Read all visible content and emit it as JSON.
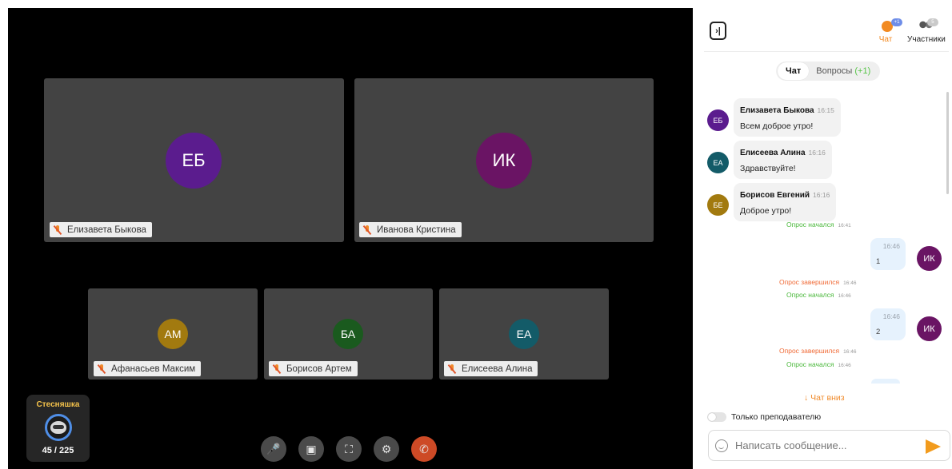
{
  "stage": {
    "tiles": [
      {
        "initials": "ЕБ",
        "name": "Елизавета Быкова",
        "color": "#5b1c8e"
      },
      {
        "initials": "ИК",
        "name": "Иванова Кристина",
        "color": "#6a1464"
      },
      {
        "initials": "АМ",
        "name": "Афанасьев Максим",
        "color": "#a27a0f"
      },
      {
        "initials": "БА",
        "name": "Борисов Артем",
        "color": "#1a5a1e"
      },
      {
        "initials": "ЕА",
        "name": "Елисеева Алина",
        "color": "#135b68"
      }
    ],
    "achievement": {
      "title": "Стесняшка",
      "count": "45 / 225",
      "progress": 0.2
    },
    "controls": [
      "mic-off-icon",
      "camera-off-icon",
      "fullscreen-icon",
      "settings-icon",
      "hangup-icon"
    ]
  },
  "panel": {
    "header": {
      "chat_label": "Чат",
      "chat_badge": "+1",
      "participants_label": "Участники",
      "participants_badge": "5",
      "accent": "#f28a21"
    },
    "tabs": {
      "chat": "Чат",
      "questions": "Вопросы",
      "questions_new": "(+1)"
    },
    "messages": [
      {
        "initials": "ЕБ",
        "author": "Елизавета Быкова",
        "time": "16:15",
        "text": "Всем доброе утро!",
        "color": "#5b1c8e"
      },
      {
        "initials": "ЕА",
        "author": "Елисеева Алина",
        "time": "16:16",
        "text": "Здравствуйте!",
        "color": "#135b68"
      },
      {
        "initials": "БЕ",
        "author": "Борисов Евгений",
        "time": "16:16",
        "text": "Доброе утро!",
        "color": "#a27a0f"
      }
    ],
    "events": [
      {
        "text": "Опрос начался",
        "time": "16:41"
      },
      {
        "text": "Опрос завершился",
        "time": "16:46"
      },
      {
        "text": "Опрос начался",
        "time": "16:46"
      },
      {
        "text": "Опрос завершился",
        "time": "16:46"
      },
      {
        "text": "Опрос начался",
        "time": "16:46"
      }
    ],
    "own_messages": [
      {
        "time": "16:46",
        "text": "1",
        "initials": "ИК",
        "color": "#6a1464"
      },
      {
        "time": "16:46",
        "text": "2",
        "initials": "ИК",
        "color": "#6a1464"
      }
    ],
    "scroll_down": "↓ Чат вниз",
    "toggle_label": "Только преподавателю",
    "input_placeholder": "Написать сообщение..."
  }
}
